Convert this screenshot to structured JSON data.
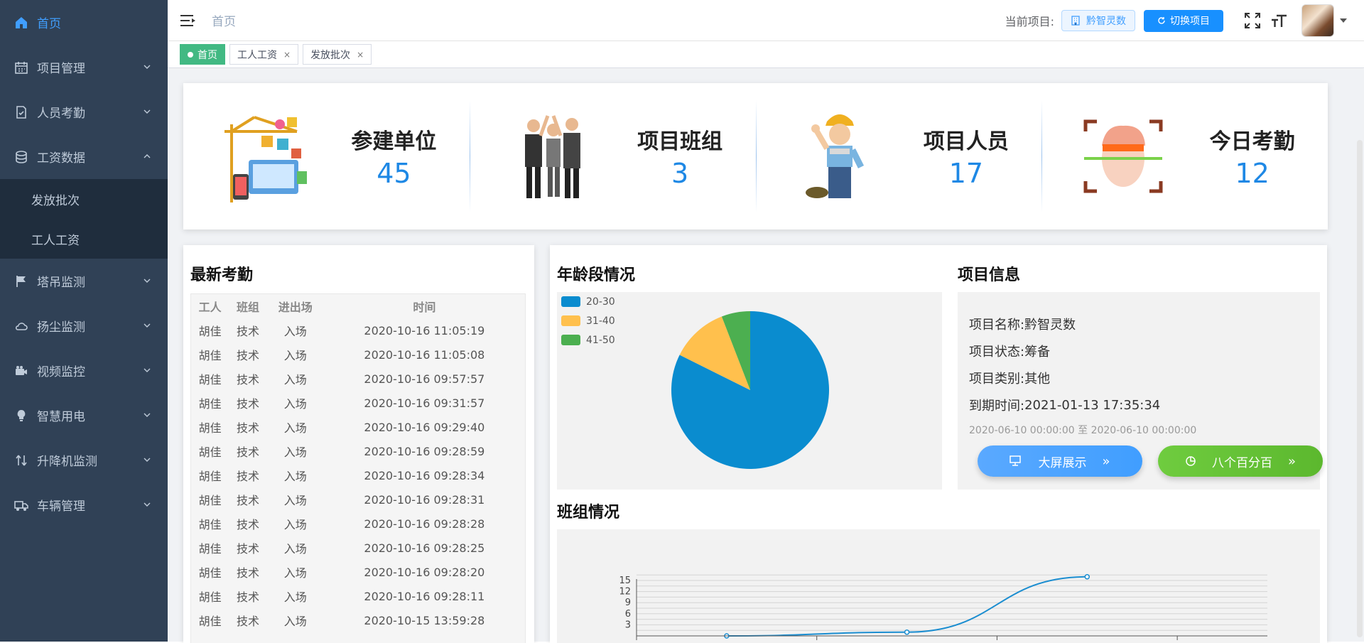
{
  "sidebar": {
    "items": [
      {
        "label": "首页",
        "icon": "home-icon",
        "active": true
      },
      {
        "label": "项目管理",
        "icon": "calendar-icon"
      },
      {
        "label": "人员考勤",
        "icon": "check-doc-icon"
      },
      {
        "label": "工资数据",
        "icon": "database-icon",
        "expanded": true
      },
      {
        "label": "塔吊监测",
        "icon": "flag-icon"
      },
      {
        "label": "扬尘监测",
        "icon": "cloud-icon"
      },
      {
        "label": "视频监控",
        "icon": "camera-icon"
      },
      {
        "label": "智慧用电",
        "icon": "bulb-icon"
      },
      {
        "label": "升降机监测",
        "icon": "elevator-icon"
      },
      {
        "label": "车辆管理",
        "icon": "truck-icon"
      }
    ],
    "sub_items": [
      "发放批次",
      "工人工资"
    ]
  },
  "header": {
    "breadcrumb": "首页",
    "project_label": "当前项目:",
    "project_name": "黔智灵数",
    "switch_label": "切换项目"
  },
  "tags": [
    {
      "label": "首页",
      "active": true
    },
    {
      "label": "工人工资"
    },
    {
      "label": "发放批次"
    }
  ],
  "stats": [
    {
      "label": "参建单位",
      "value": "45",
      "icon": "construction-illustration"
    },
    {
      "label": "项目班组",
      "value": "3",
      "icon": "team-illustration"
    },
    {
      "label": "项目人员",
      "value": "17",
      "icon": "worker-illustration"
    },
    {
      "label": "今日考勤",
      "value": "12",
      "icon": "face-scan-illustration"
    }
  ],
  "attendance": {
    "title": "最新考勤",
    "columns": [
      "工人",
      "班组",
      "进出场",
      "时间"
    ],
    "rows": [
      [
        "胡佳",
        "技术",
        "入场",
        "2020-10-16 11:05:19"
      ],
      [
        "胡佳",
        "技术",
        "入场",
        "2020-10-16 11:05:08"
      ],
      [
        "胡佳",
        "技术",
        "入场",
        "2020-10-16 09:57:57"
      ],
      [
        "胡佳",
        "技术",
        "入场",
        "2020-10-16 09:31:57"
      ],
      [
        "胡佳",
        "技术",
        "入场",
        "2020-10-16 09:29:40"
      ],
      [
        "胡佳",
        "技术",
        "入场",
        "2020-10-16 09:28:59"
      ],
      [
        "胡佳",
        "技术",
        "入场",
        "2020-10-16 09:28:34"
      ],
      [
        "胡佳",
        "技术",
        "入场",
        "2020-10-16 09:28:31"
      ],
      [
        "胡佳",
        "技术",
        "入场",
        "2020-10-16 09:28:28"
      ],
      [
        "胡佳",
        "技术",
        "入场",
        "2020-10-16 09:28:25"
      ],
      [
        "胡佳",
        "技术",
        "入场",
        "2020-10-16 09:28:20"
      ],
      [
        "胡佳",
        "技术",
        "入场",
        "2020-10-16 09:28:11"
      ],
      [
        "胡佳",
        "技术",
        "入场",
        "2020-10-15 13:59:28"
      ]
    ]
  },
  "age_section": {
    "title": "年龄段情况"
  },
  "project_info": {
    "title": "项目信息",
    "lines": [
      {
        "k": "项目名称:",
        "v": "黔智灵数"
      },
      {
        "k": "项目状态:",
        "v": "筹备"
      },
      {
        "k": "项目类别:",
        "v": "其他"
      },
      {
        "k": "到期时间:",
        "v": "2021-01-13 17:35:34"
      }
    ],
    "range": "2020-06-10 00:00:00 至 2020-06-10 00:00:00",
    "btn_screen": "大屏展示",
    "btn_eight": "八个百分百"
  },
  "team_section": {
    "title": "班组情况"
  },
  "colors": {
    "sidebar": "#304156",
    "accent": "#409eff",
    "tag_active": "#42b983",
    "pie_1": "#0a8ccf",
    "pie_2": "#ffc04d",
    "pie_3": "#4caf50",
    "btn_blue": "#409eff",
    "btn_green": "#67c23a"
  },
  "chart_data": [
    {
      "type": "pie",
      "categories": [
        "20-30",
        "31-40",
        "41-50"
      ],
      "values": [
        14,
        2,
        1
      ]
    },
    {
      "type": "line",
      "y_ticks": [
        "3",
        "6",
        "9",
        "12",
        "15"
      ],
      "series": [
        {
          "values": [
            0,
            1,
            16
          ]
        }
      ]
    }
  ]
}
